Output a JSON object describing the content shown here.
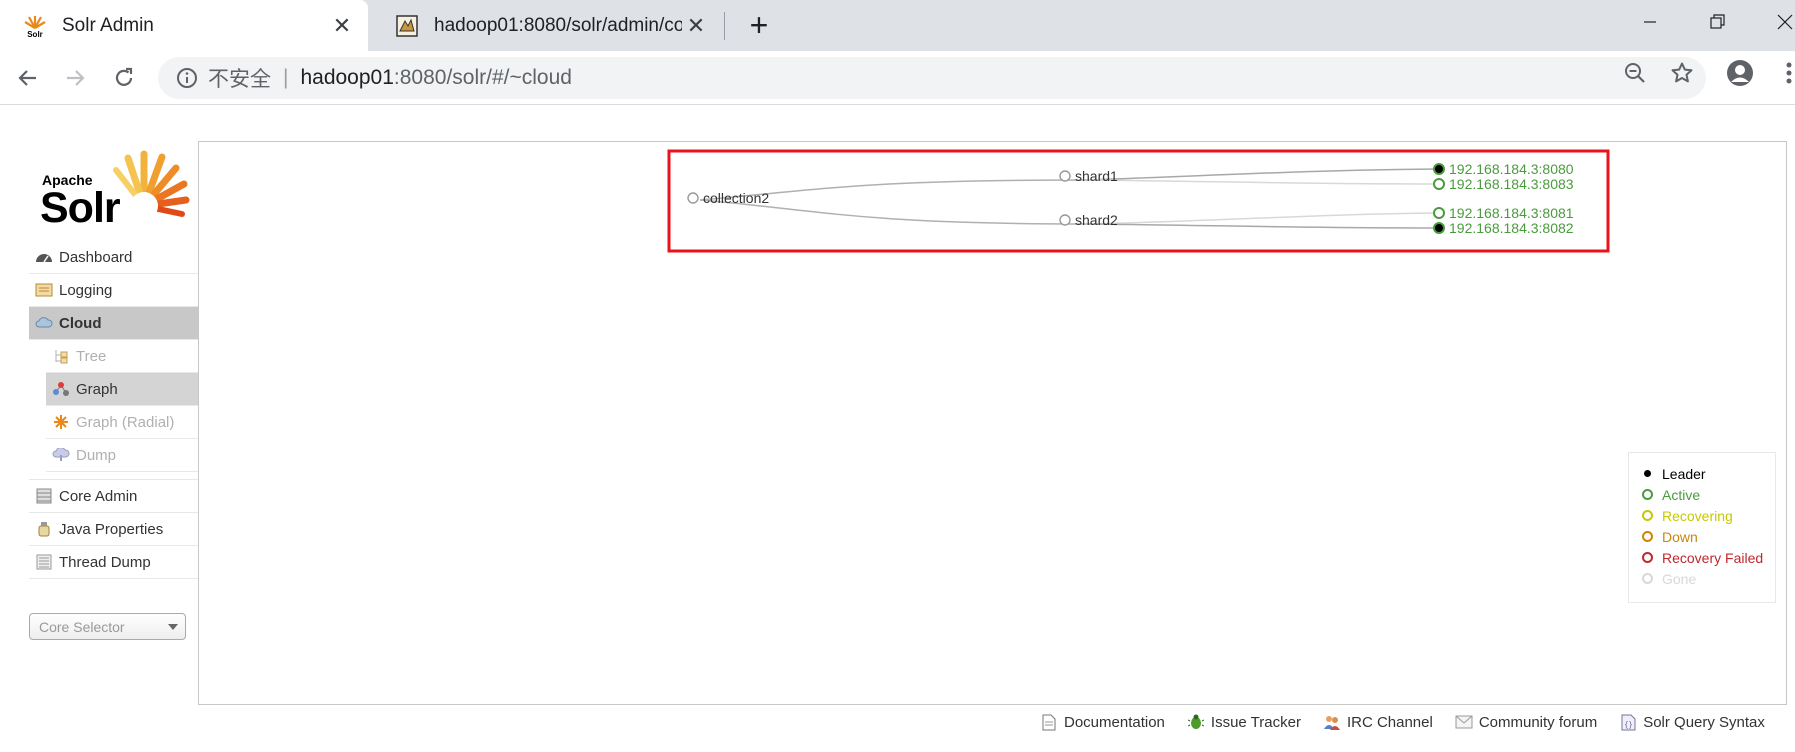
{
  "browser": {
    "tabs": [
      {
        "title": "Solr Admin",
        "active": true
      },
      {
        "title": "hadoop01:8080/solr/admin/co",
        "active": false
      }
    ],
    "url": {
      "security_label": "不安全",
      "separator": "|",
      "host": "hadoop01",
      "path": ":8080/solr/#/~cloud"
    }
  },
  "logo": {
    "apache": "Apache",
    "solr": "Solr"
  },
  "sidebar": {
    "items": [
      {
        "label": "Dashboard",
        "icon": "dashboard-icon"
      },
      {
        "label": "Logging",
        "icon": "logging-icon"
      },
      {
        "label": "Cloud",
        "icon": "cloud-icon",
        "selected": true
      }
    ],
    "cloud_sub": [
      {
        "label": "Tree",
        "icon": "tree-icon",
        "dim": true
      },
      {
        "label": "Graph",
        "icon": "graph-icon",
        "selected": true
      },
      {
        "label": "Graph (Radial)",
        "icon": "radial-icon",
        "dim": true
      },
      {
        "label": "Dump",
        "icon": "dump-icon",
        "dim": true
      }
    ],
    "items2": [
      {
        "label": "Core Admin",
        "icon": "core-admin-icon"
      },
      {
        "label": "Java Properties",
        "icon": "java-icon"
      },
      {
        "label": "Thread Dump",
        "icon": "thread-dump-icon"
      }
    ],
    "core_selector": "Core Selector"
  },
  "graph": {
    "collection": "collection2",
    "shards": [
      {
        "name": "shard1",
        "replicas": [
          {
            "addr": "192.168.184.3:8080",
            "state": "leader"
          },
          {
            "addr": "192.168.184.3:8083",
            "state": "active"
          }
        ]
      },
      {
        "name": "shard2",
        "replicas": [
          {
            "addr": "192.168.184.3:8081",
            "state": "active"
          },
          {
            "addr": "192.168.184.3:8082",
            "state": "leader"
          }
        ]
      }
    ],
    "highlight_color": "#e8141b",
    "replica_text_color": "#4a9b3d"
  },
  "legend": [
    {
      "label": "Leader",
      "color": "#000000"
    },
    {
      "label": "Active",
      "color": "#4a9b3d"
    },
    {
      "label": "Recovering",
      "color": "#c8c800"
    },
    {
      "label": "Down",
      "color": "#c8870a"
    },
    {
      "label": "Recovery Failed",
      "color": "#c0282d"
    },
    {
      "label": "Gone",
      "color": "#d8d8d8"
    }
  ],
  "footer": [
    {
      "label": "Documentation",
      "icon": "document-icon"
    },
    {
      "label": "Issue Tracker",
      "icon": "bug-icon"
    },
    {
      "label": "IRC Channel",
      "icon": "irc-icon"
    },
    {
      "label": "Community forum",
      "icon": "mail-icon"
    },
    {
      "label": "Solr Query Syntax",
      "icon": "query-syntax-icon"
    }
  ]
}
